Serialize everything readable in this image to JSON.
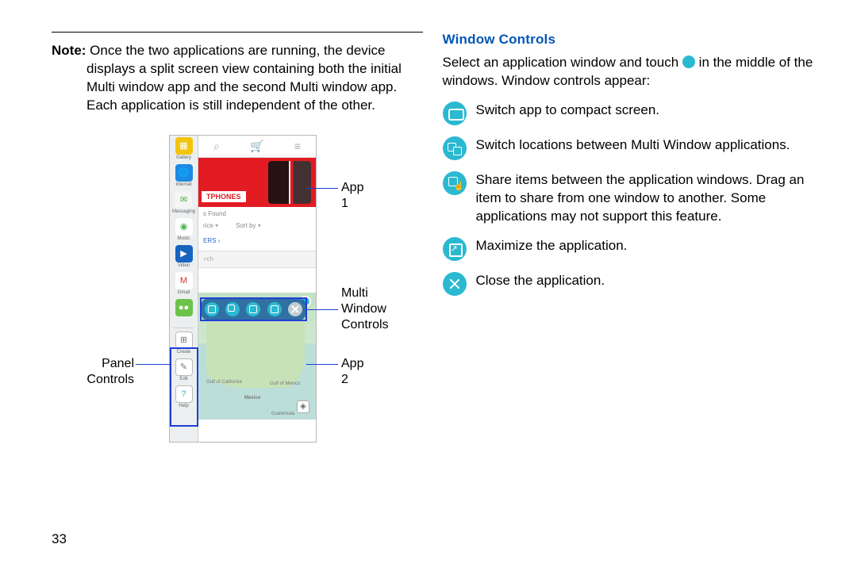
{
  "left": {
    "note_label": "Note:",
    "note_text": " Once the two applications are running, the device displays a split screen view containing both the initial Multi window app and the second Multi window app. Each application is still independent of the other.",
    "callouts": {
      "panel_controls_1": "Panel",
      "panel_controls_2": "Controls",
      "app1": "App 1",
      "mw1": "Multi",
      "mw2": "Window",
      "mw3": "Controls",
      "app2": "App 2"
    },
    "tray": {
      "gallery": "Gallery",
      "internet": "Internet",
      "messaging": "Messaging",
      "music": "Music",
      "video": "Video",
      "gmail": "Gmail",
      "create": "Create",
      "edit": "Edit",
      "help": "Help"
    },
    "app1": {
      "tag": "TPHONES",
      "found": "s Found",
      "filter1": "rice",
      "filter2": "Sort by",
      "ers": "ERS ›",
      "search": "ch"
    },
    "map": {
      "gulfcal": "Gulf of California",
      "mexico": "Mexico",
      "gulfmex": "Gulf of Mexico",
      "guat": "Guatemala"
    }
  },
  "right": {
    "heading": "Window Controls",
    "intro_a": "Select an application window and touch ",
    "intro_b": " in the middle of the windows. Window controls appear:",
    "items": {
      "compact": "Switch app to compact screen.",
      "swap": "Switch locations between Multi Window applications.",
      "share": "Share items between the application windows. Drag an item to share from one window to another. Some applications may not support this feature.",
      "maximize": "Maximize the application.",
      "close": "Close the application."
    }
  },
  "page_number": "33"
}
